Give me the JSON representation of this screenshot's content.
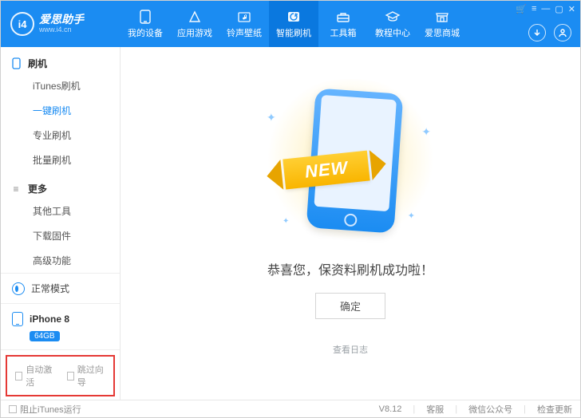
{
  "app": {
    "name": "爱思助手",
    "url": "www.i4.cn"
  },
  "nav": {
    "items": [
      {
        "label": "我的设备"
      },
      {
        "label": "应用游戏"
      },
      {
        "label": "铃声壁纸"
      },
      {
        "label": "智能刷机"
      },
      {
        "label": "工具箱"
      },
      {
        "label": "教程中心"
      },
      {
        "label": "爱思商城"
      }
    ]
  },
  "sidebar": {
    "flash_group": "刷机",
    "flash_items": [
      "iTunes刷机",
      "一键刷机",
      "专业刷机",
      "批量刷机"
    ],
    "more_group": "更多",
    "more_items": [
      "其他工具",
      "下载固件",
      "高级功能"
    ],
    "mode_label": "正常模式",
    "device_name": "iPhone 8",
    "device_storage": "64GB",
    "auto_activate": "自动激活",
    "skip_wizard": "跳过向导"
  },
  "main": {
    "banner_text": "NEW",
    "message": "恭喜您，保资料刷机成功啦！",
    "confirm": "确定",
    "view_log": "查看日志"
  },
  "status": {
    "block_itunes": "阻止iTunes运行",
    "version": "V8.12",
    "support": "客服",
    "wechat": "微信公众号",
    "update": "检查更新"
  }
}
